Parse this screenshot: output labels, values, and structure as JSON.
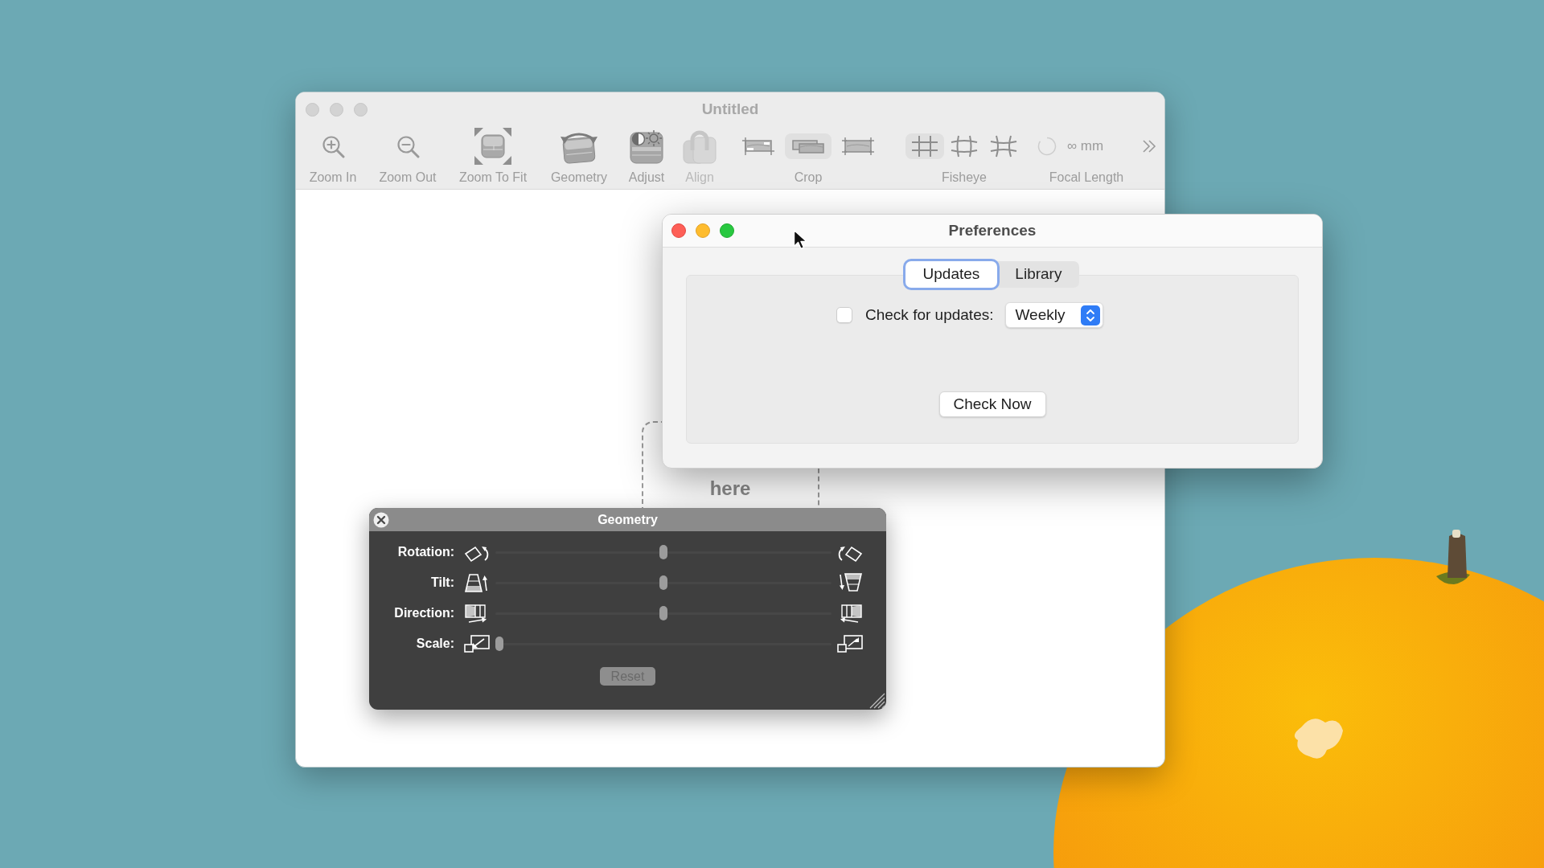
{
  "main_window": {
    "title": "Untitled",
    "active": false,
    "toolbar": [
      {
        "kind": "button",
        "label": "Zoom In",
        "disabled": false
      },
      {
        "kind": "button",
        "label": "Zoom Out",
        "disabled": false
      },
      {
        "kind": "button",
        "label": "Zoom To Fit",
        "disabled": false
      },
      {
        "kind": "button",
        "label": "Geometry",
        "disabled": false
      },
      {
        "kind": "button",
        "label": "Adjust",
        "disabled": false
      },
      {
        "kind": "button",
        "label": "Align",
        "disabled": true
      },
      {
        "kind": "segmented",
        "label": "Crop",
        "options": [
          {
            "selected": false
          },
          {
            "selected": true
          },
          {
            "selected": false
          }
        ]
      },
      {
        "kind": "segmented",
        "label": "Fisheye",
        "options": [
          {
            "selected": true
          },
          {
            "selected": false
          },
          {
            "selected": false
          }
        ]
      },
      {
        "kind": "field",
        "label": "Focal Length",
        "value": "∞ mm"
      }
    ],
    "drop_zone": {
      "text": "here"
    }
  },
  "preferences_window": {
    "title": "Preferences",
    "active": true,
    "tabs": [
      {
        "label": "Updates",
        "selected": true
      },
      {
        "label": "Library",
        "selected": false
      }
    ],
    "update_check": {
      "label": "Check for updates:",
      "checked": false
    },
    "frequency_popup": {
      "value": "Weekly"
    },
    "check_now_button": {
      "label": "Check Now"
    }
  },
  "geometry_panel": {
    "title": "Geometry",
    "sliders": [
      {
        "label": "Rotation:",
        "level": 0.5
      },
      {
        "label": "Tilt:",
        "level": 0.5
      },
      {
        "label": "Direction:",
        "level": 0.5
      },
      {
        "label": "Scale:",
        "level": 0
      }
    ],
    "reset_button": {
      "label": "Reset",
      "disabled": true
    }
  }
}
